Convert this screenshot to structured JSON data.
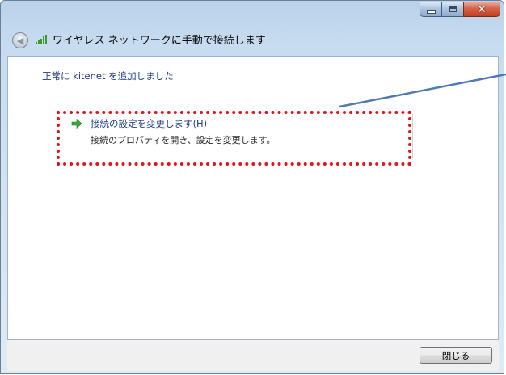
{
  "window": {
    "title": "ワイヤレス ネットワークに手動で接続します",
    "caption_close": "✕"
  },
  "content": {
    "success_message": "正常に kitenet を追加しました",
    "option": {
      "title": "接続の設定を変更します(H)",
      "description": "接続のプロパティを開き、設定を変更します。"
    }
  },
  "footer": {
    "close_label": "閉じる"
  },
  "colors": {
    "annotation": "#e4141a",
    "pointer": "#4f79b0",
    "link_text": "#1f3c86",
    "arrow": "#3aa83a"
  }
}
